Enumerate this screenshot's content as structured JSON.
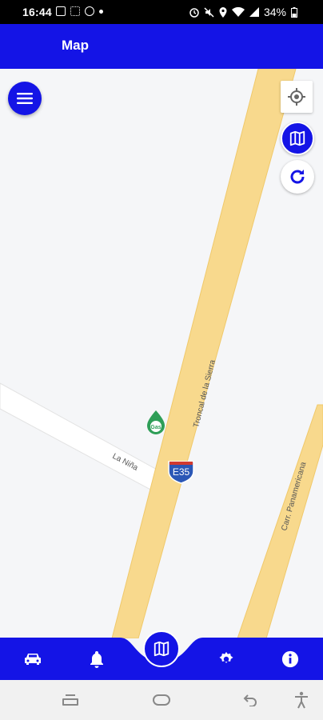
{
  "status_bar": {
    "time": "16:44",
    "battery": "34%",
    "icons": [
      "gallery-icon",
      "network-stats-icon",
      "messenger-icon",
      "dot-icon",
      "alarm-icon",
      "mute-icon",
      "location-icon",
      "wifi-icon",
      "signal-icon",
      "battery-icon"
    ]
  },
  "app_bar": {
    "title": "Map"
  },
  "map": {
    "roads": [
      {
        "label": "Troncal de la Sierra"
      },
      {
        "label": "La Niña"
      },
      {
        "label": "Carr. Panamericana"
      }
    ],
    "shield": {
      "label": "E35"
    },
    "marker": {
      "label": "Gas"
    }
  },
  "controls": {
    "menu": "menu-icon",
    "locate": "my-location-icon",
    "map_type": "map-icon",
    "refresh": "refresh-icon"
  },
  "bottom_nav": {
    "items": [
      {
        "name": "car",
        "icon": "car-icon"
      },
      {
        "name": "notifications",
        "icon": "bell-icon"
      },
      {
        "name": "map",
        "icon": "map-icon"
      },
      {
        "name": "settings",
        "icon": "gear-icon"
      },
      {
        "name": "info",
        "icon": "info-icon"
      }
    ]
  },
  "colors": {
    "primary": "#1414e6",
    "road_major": "#f8d98d",
    "map_background": "#f5f6f8"
  }
}
